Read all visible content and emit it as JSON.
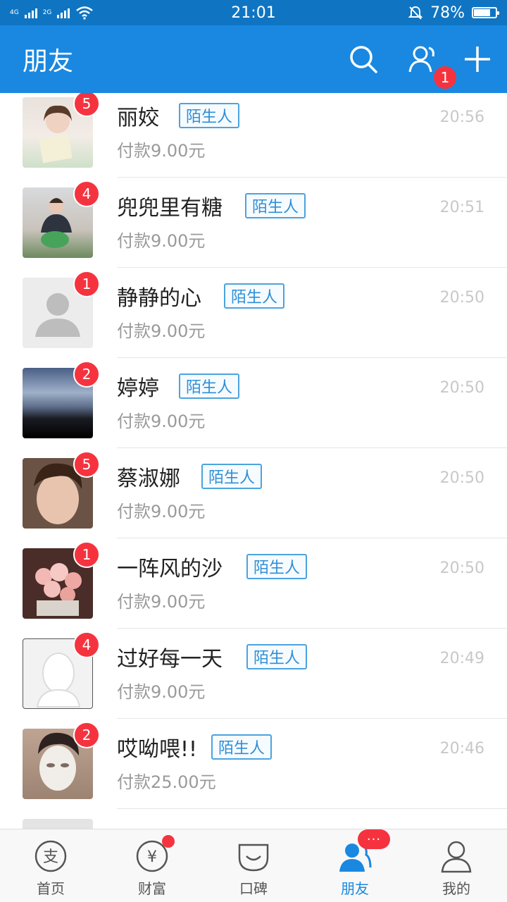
{
  "status_bar": {
    "signal1_label": "4G",
    "signal2_label": "2G",
    "time": "21:01",
    "battery_text": "78%",
    "battery_level": 0.78
  },
  "header": {
    "title": "朋友",
    "contacts_badge": "1"
  },
  "conversations": [
    {
      "name": "丽姣",
      "tag": "陌生人",
      "subtitle": "付款9.00元",
      "time": "20:56",
      "badge": "5",
      "avatar": "photo-girl"
    },
    {
      "name": "兜兜里有糖",
      "tag": "陌生人",
      "subtitle": "付款9.00元",
      "time": "20:51",
      "badge": "4",
      "avatar": "photo-woman"
    },
    {
      "name": "静静的心",
      "tag": "陌生人",
      "subtitle": "付款9.00元",
      "time": "20:50",
      "badge": "1",
      "avatar": "default-avatar"
    },
    {
      "name": "婷婷",
      "tag": "陌生人",
      "subtitle": "付款9.00元",
      "time": "20:50",
      "badge": "2",
      "avatar": "photo-sky"
    },
    {
      "name": "蔡淑娜",
      "tag": "陌生人",
      "subtitle": "付款9.00元",
      "time": "20:50",
      "badge": "5",
      "avatar": "photo-face"
    },
    {
      "name": "一阵风的沙",
      "tag": "陌生人",
      "subtitle": "付款9.00元",
      "time": "20:50",
      "badge": "1",
      "avatar": "photo-flowers"
    },
    {
      "name": "过好每一天",
      "tag": "陌生人",
      "subtitle": "付款9.00元",
      "time": "20:49",
      "badge": "4",
      "avatar": "photo-silhouette"
    },
    {
      "name": "哎呦喂!!",
      "tag": "陌生人",
      "subtitle": "付款25.00元",
      "time": "20:46",
      "badge": "2",
      "avatar": "photo-mask"
    }
  ],
  "bottom_nav": [
    {
      "label": "首页",
      "icon": "home-pay-icon"
    },
    {
      "label": "财富",
      "icon": "wealth-icon"
    },
    {
      "label": "口碑",
      "icon": "koubei-icon"
    },
    {
      "label": "朋友",
      "icon": "friends-icon",
      "active": true,
      "badge": "···"
    },
    {
      "label": "我的",
      "icon": "profile-icon"
    }
  ],
  "colors": {
    "status_bar": "#0f75c2",
    "header": "#1a88e0",
    "badge": "#f5333f",
    "tag_border": "#4ca3de",
    "active_tab": "#1a88e0"
  }
}
